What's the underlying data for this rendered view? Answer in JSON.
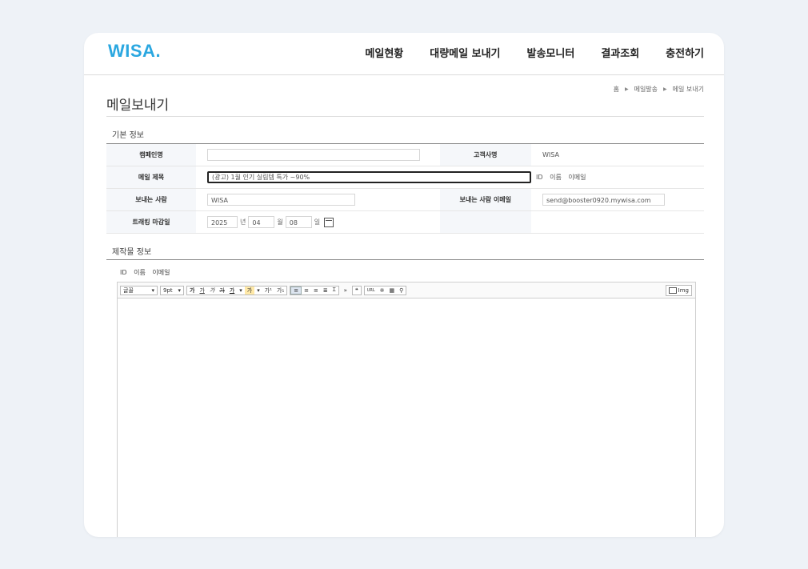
{
  "logo": "WISA.",
  "nav": [
    "메일현황",
    "대량메일 보내기",
    "발송모니터",
    "결과조회",
    "충전하기"
  ],
  "breadcrumb": [
    "홈",
    "메일발송",
    "메일 보내기"
  ],
  "page_title": "메일보내기",
  "basic_info": {
    "section_title": "기본 정보",
    "campaign_label": "캠페인명",
    "campaign_value": "",
    "company_label": "고객사명",
    "company_value": "WISA",
    "subject_label": "메일 제목",
    "subject_value": "(광고) 1월 인기 실림템 특가 ~90%",
    "subject_vars": [
      "ID",
      "이름",
      "이메일"
    ],
    "sender_label": "보내는 사람",
    "sender_value": "WISA",
    "sender_email_label": "보내는 사람 이메일",
    "sender_email_value": "send@booster0920.mywisa.com",
    "tracking_label": "트래킹 마감일",
    "tracking_year": "2025",
    "year_unit": "년",
    "tracking_month": "04",
    "month_unit": "월",
    "tracking_day": "08",
    "day_unit": "일"
  },
  "content_info": {
    "section_title": "제작물 정보",
    "vars": [
      "ID",
      "이름",
      "이메일"
    ]
  },
  "toolbar": {
    "font": "글꼴",
    "size": "9pt",
    "format": [
      "가",
      "가",
      "가",
      "가",
      "가"
    ],
    "color": "가",
    "super": "가¹",
    "sub": "가₁",
    "more": "»",
    "quote": "❝",
    "url": "URL",
    "special": "※",
    "table": "▦",
    "search": "🔍",
    "img": "Img"
  }
}
